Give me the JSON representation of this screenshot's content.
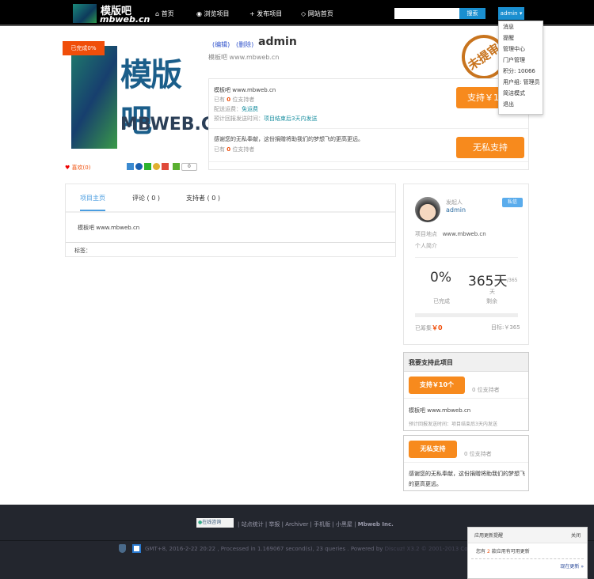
{
  "header": {
    "logo_cn": "模版吧",
    "logo_en": "mbweb.cn",
    "nav": [
      "首页",
      "浏览项目",
      "发布项目",
      "网站首页"
    ],
    "search_placeholder": "",
    "search_button": "搜索",
    "user": "admin"
  },
  "user_menu": [
    "消息",
    "提醒",
    "管理中心",
    "门户管理",
    "积分: 10066",
    "用户组: 管理员",
    "简洁模式",
    "退出"
  ],
  "project": {
    "progress_badge": "已完成0%",
    "edit": "(编辑)",
    "delete": "(删除)",
    "title": "admin",
    "subtitle": "模板吧 www.mbweb.cn",
    "stamp": "未提审",
    "like": "喜欢(0)",
    "share_count": "0"
  },
  "rewards": [
    {
      "desc": "模板吧 www.mbweb.cn",
      "supporters_pre": "已有",
      "supporters": "0",
      "supporters_post": "位支持者",
      "shipping_label": "配送运费：",
      "shipping": "免运费",
      "time_label": "预计回报发送时间：",
      "time": "项目结束后3天内发送",
      "button": "支持￥10个"
    },
    {
      "desc": "感谢您的无私奉献，这份捐赠将助我们的梦想飞的更高更远。",
      "supporters_pre": "已有",
      "supporters": "0",
      "supporters_post": "位支持者",
      "button": "无私支持"
    }
  ],
  "tabs": [
    "项目主页",
    "评论 ( 0 )",
    "支持者 ( 0 )"
  ],
  "content": "模板吧 www.mbweb.cn",
  "tags_label": "标签：",
  "sidebar": {
    "initiator_label": "发起人",
    "initiator": "admin",
    "message_btn": "私信",
    "location_label": "项目地点",
    "location": "www.mbweb.cn",
    "bio": "个人简介",
    "percent": "0%",
    "percent_label": "已完成",
    "days": "365天",
    "days_total": "/365",
    "days_unit": "天",
    "days_label": "剩余",
    "raised_label": "已筹集",
    "raised": "￥0",
    "goal": "目标:￥365",
    "progress": 0
  },
  "support_box": {
    "title": "我要支持此项目",
    "button": "支持￥10个",
    "count": "0 位支持者",
    "desc": "模板吧 www.mbweb.cn",
    "time": "预计回报发送时间：项目结束后3天内发送"
  },
  "support_box2": {
    "button": "无私支持",
    "count": "0 位支持者",
    "desc": "感谢您的无私奉献，这份捐赠将助我们的梦想飞的更高更远。"
  },
  "footer": {
    "consult": "在线咨询",
    "links": [
      "站点统计",
      "举报",
      "Archiver",
      "手机版",
      "小黑屋"
    ],
    "brand": "Mbweb Inc.",
    "info": "GMT+8, 2016-2-22 20:22 , Processed in 1.169067 second(s), 23 queries . Powered by",
    "discuz": "Discuz! X3.2 © 2001-2013 Comsenz Inc."
  },
  "popup": {
    "title": "应用更新提醒",
    "close": "关闭",
    "msg_pre": "您有",
    "count": "2",
    "msg_post": "款应用有可用更新",
    "action": "现在更新 »"
  }
}
